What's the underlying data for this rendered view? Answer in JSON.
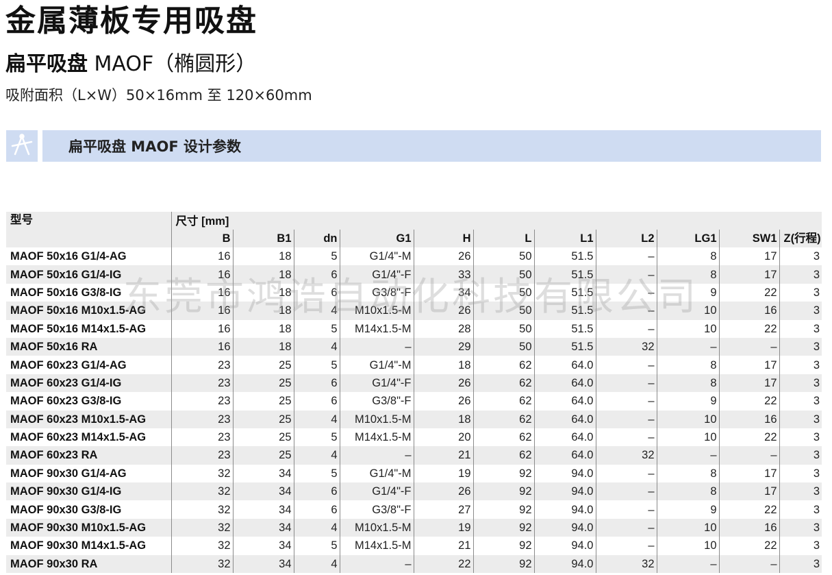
{
  "page": {
    "title": "金属薄板专用吸盘",
    "subtitle_bold": "扁平吸盘",
    "subtitle_rest": " MAOF（椭圆形）",
    "area_text": "吸附面积（L×W）50×16mm 至 120×60mm"
  },
  "section": {
    "icon": "caliper-icon",
    "title": "扁平吸盘 MAOF  设计参数"
  },
  "watermark": "东莞市鸿诰自动化科技有限公司",
  "table": {
    "model_header": "型号",
    "dim_header": "尺寸 [mm]",
    "columns": [
      "B",
      "B1",
      "dn",
      "G1",
      "H",
      "L",
      "L1",
      "L2",
      "LG1",
      "SW1",
      "Z(行程)"
    ],
    "rows": [
      [
        "MAOF 50x16 G1/4-AG",
        "16",
        "18",
        "5",
        "G1/4\"-M",
        "26",
        "50",
        "51.5",
        "–",
        "8",
        "17",
        "3"
      ],
      [
        "MAOF 50x16 G1/4-IG",
        "16",
        "18",
        "6",
        "G1/4\"-F",
        "33",
        "50",
        "51.5",
        "–",
        "8",
        "17",
        "3"
      ],
      [
        "MAOF 50x16 G3/8-IG",
        "16",
        "18",
        "6",
        "G3/8\"-F",
        "34",
        "50",
        "51.5",
        "–",
        "9",
        "22",
        "3"
      ],
      [
        "MAOF 50x16 M10x1.5-AG",
        "16",
        "18",
        "4",
        "M10x1.5-M",
        "26",
        "50",
        "51.5",
        "–",
        "10",
        "16",
        "3"
      ],
      [
        "MAOF 50x16 M14x1.5-AG",
        "16",
        "18",
        "5",
        "M14x1.5-M",
        "28",
        "50",
        "51.5",
        "–",
        "10",
        "22",
        "3"
      ],
      [
        "MAOF 50x16 RA",
        "16",
        "18",
        "4",
        "–",
        "29",
        "50",
        "51.5",
        "32",
        "–",
        "–",
        "3"
      ],
      [
        "MAOF 60x23 G1/4-AG",
        "23",
        "25",
        "5",
        "G1/4\"-M",
        "18",
        "62",
        "64.0",
        "–",
        "8",
        "17",
        "3"
      ],
      [
        "MAOF 60x23 G1/4-IG",
        "23",
        "25",
        "6",
        "G1/4\"-F",
        "26",
        "62",
        "64.0",
        "–",
        "8",
        "17",
        "3"
      ],
      [
        "MAOF 60x23 G3/8-IG",
        "23",
        "25",
        "6",
        "G3/8\"-F",
        "26",
        "62",
        "64.0",
        "–",
        "9",
        "22",
        "3"
      ],
      [
        "MAOF 60x23 M10x1.5-AG",
        "23",
        "25",
        "4",
        "M10x1.5-M",
        "18",
        "62",
        "64.0",
        "–",
        "10",
        "16",
        "3"
      ],
      [
        "MAOF 60x23 M14x1.5-AG",
        "23",
        "25",
        "5",
        "M14x1.5-M",
        "20",
        "62",
        "64.0",
        "–",
        "10",
        "22",
        "3"
      ],
      [
        "MAOF 60x23 RA",
        "23",
        "25",
        "4",
        "–",
        "21",
        "62",
        "64.0",
        "32",
        "–",
        "–",
        "3"
      ],
      [
        "MAOF 90x30 G1/4-AG",
        "32",
        "34",
        "5",
        "G1/4\"-M",
        "19",
        "92",
        "94.0",
        "–",
        "8",
        "17",
        "3"
      ],
      [
        "MAOF 90x30 G1/4-IG",
        "32",
        "34",
        "6",
        "G1/4\"-F",
        "26",
        "92",
        "94.0",
        "–",
        "8",
        "17",
        "3"
      ],
      [
        "MAOF 90x30 G3/8-IG",
        "32",
        "34",
        "6",
        "G3/8\"-F",
        "27",
        "92",
        "94.0",
        "–",
        "9",
        "22",
        "3"
      ],
      [
        "MAOF 90x30 M10x1.5-AG",
        "32",
        "34",
        "4",
        "M10x1.5-M",
        "19",
        "92",
        "94.0",
        "–",
        "10",
        "16",
        "3"
      ],
      [
        "MAOF 90x30 M14x1.5-AG",
        "32",
        "34",
        "5",
        "M14x1.5-M",
        "21",
        "92",
        "94.0",
        "–",
        "10",
        "22",
        "3"
      ],
      [
        "MAOF 90x30 RA",
        "32",
        "34",
        "4",
        "–",
        "22",
        "92",
        "94.0",
        "32",
        "–",
        "–",
        "3"
      ]
    ]
  },
  "colors": {
    "band_background": "#cfdcf2",
    "row_shading": "#ececec",
    "text": "#111111"
  }
}
